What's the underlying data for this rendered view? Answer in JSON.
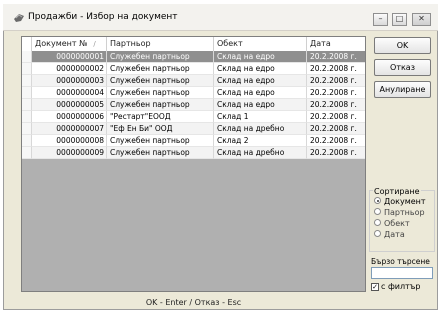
{
  "window": {
    "title": "Продажби - Избор на документ"
  },
  "grid": {
    "columns": [
      "Документ №",
      "Партньор",
      "Обект",
      "Дата"
    ],
    "rows": [
      {
        "doc": "0000000001",
        "partner": "Служебен партньор",
        "object": "Склад на едро",
        "date": "20.2.2008 г.",
        "selected": true
      },
      {
        "doc": "0000000002",
        "partner": "Служебен партньор",
        "object": "Склад на едро",
        "date": "20.2.2008 г.",
        "selected": false
      },
      {
        "doc": "0000000003",
        "partner": "Служебен партньор",
        "object": "Склад на едро",
        "date": "20.2.2008 г.",
        "selected": false
      },
      {
        "doc": "0000000004",
        "partner": "Служебен партньор",
        "object": "Склад на едро",
        "date": "20.2.2008 г.",
        "selected": false
      },
      {
        "doc": "0000000005",
        "partner": "Служебен партньор",
        "object": "Склад на едро",
        "date": "20.2.2008 г.",
        "selected": false
      },
      {
        "doc": "0000000006",
        "partner": "\"Рестарт\"ЕООД",
        "object": "Склад 1",
        "date": "20.2.2008 г.",
        "selected": false
      },
      {
        "doc": "0000000007",
        "partner": "\"Еф Ен Би\" ООД",
        "object": "Склад на дребно",
        "date": "20.2.2008 г.",
        "selected": false
      },
      {
        "doc": "0000000008",
        "partner": "Служебен партньор",
        "object": "Склад 2",
        "date": "20.2.2008 г.",
        "selected": false
      },
      {
        "doc": "0000000009",
        "partner": "Служебен партньор",
        "object": "Склад на дребно",
        "date": "20.2.2008 г.",
        "selected": false
      }
    ]
  },
  "buttons": {
    "ok": "OK",
    "cancel": "Отказ",
    "annul": "Анулиране"
  },
  "sort": {
    "title": "Сортиране",
    "options": [
      "Документ",
      "Партньор",
      "Обект",
      "Дата"
    ],
    "selected_index": 0
  },
  "quick_search": {
    "label": "Бързо търсене",
    "value": ""
  },
  "filter": {
    "label": "с филтър",
    "checked": true
  },
  "footer": {
    "hint": "OK - Enter / Отказ - Esc"
  }
}
